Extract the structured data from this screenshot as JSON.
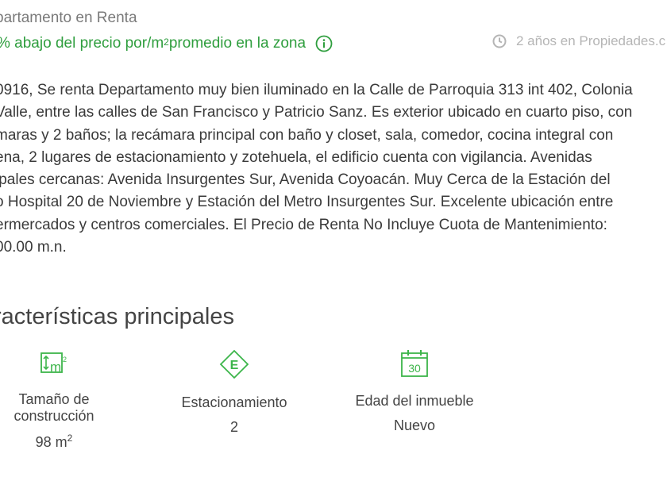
{
  "listing": {
    "subtitle": "partamento en Renta",
    "price_note": "% abajo del precio por/m",
    "price_note_sup": "2",
    "price_note_rest": " promedio en la zona",
    "published": "2 años en Propiedades.c"
  },
  "description": {
    "lines": [
      "0916, Se renta Departamento muy bien iluminado en la Calle de Parroquia 313 int 402, Colonia",
      "Valle, entre las calles de San Francisco y Patricio Sanz. Es exterior ubicado en cuarto piso, con",
      "maras y 2 baños; la recámara principal con baño y closet, sala, comedor, cocina integral con",
      "ena, 2 lugares de estacionamiento y zotehuela, el edificio cuenta con vigilancia. Avenidas",
      "ipales cercanas: Avenida Insurgentes Sur, Avenida Coyoacán. Muy Cerca de la Estación del",
      "o Hospital 20 de Noviembre y Estación del Metro Insurgentes Sur. Excelente ubicación entre",
      "ermercados y centros comerciales. El Precio de Renta No Incluye Cuota de Mantenimiento:",
      "00.00 m.n."
    ]
  },
  "features": {
    "title": "racterísticas principales",
    "items": [
      {
        "label_line1": "Tamaño de",
        "label_line2": "construcción",
        "value": "98 m",
        "value_sup": "2",
        "icon": "area-m2-icon",
        "icon_text": "m",
        "icon_sup": "2"
      },
      {
        "label": "Estacionamiento",
        "value": "2",
        "icon": "parking-icon",
        "icon_text": "E"
      },
      {
        "label": "Edad del inmueble",
        "value": "Nuevo",
        "icon": "calendar-icon",
        "icon_text": "30"
      }
    ]
  },
  "colors": {
    "accent_green": "#2f9e3e",
    "icon_green": "#3cb54a",
    "muted": "#b5b5b5"
  }
}
